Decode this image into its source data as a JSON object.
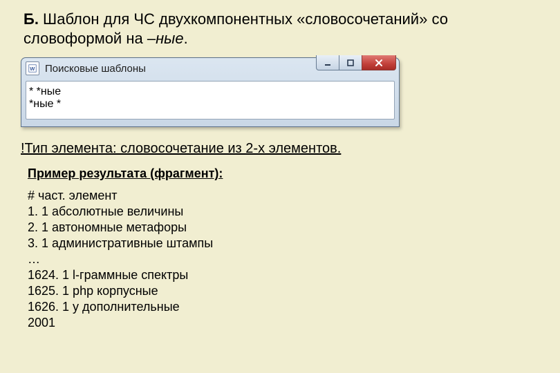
{
  "heading": {
    "prefix": "Б.",
    "rest": " Шаблон для ЧС двухкомпонентных «словосочетаний» со словоформой на –",
    "ital": "ные",
    "suffix": "."
  },
  "window": {
    "title": "Поисковые шаблоны",
    "patterns": [
      "* *ные",
      "*ные *"
    ]
  },
  "note": "!Тип элемента: словосочетание из 2-х элементов.",
  "subhead": "Пример результата (фрагмент):",
  "results_header": "# част. элемент",
  "results": [
    "1. 1 абсолютные величины",
    "2. 1 автономные метафоры",
    "3. 1 административные штампы",
    "…",
    "1624. 1 l-граммные спектры",
    "1625. 1 php корпусные",
    "1626. 1 у дополнительные",
    " 2001"
  ],
  "icons": {
    "app": "word-icon",
    "minimize": "minimize-icon",
    "maximize": "maximize-icon",
    "close": "close-icon"
  }
}
